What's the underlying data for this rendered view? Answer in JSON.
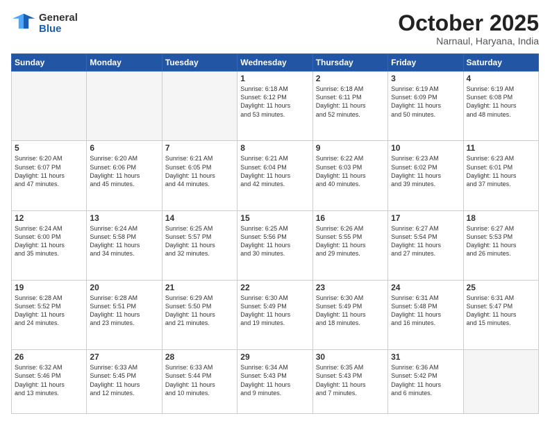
{
  "header": {
    "logo_general": "General",
    "logo_blue": "Blue",
    "month_title": "October 2025",
    "location": "Narnaul, Haryana, India"
  },
  "days_of_week": [
    "Sunday",
    "Monday",
    "Tuesday",
    "Wednesday",
    "Thursday",
    "Friday",
    "Saturday"
  ],
  "weeks": [
    [
      {
        "day": "",
        "info": ""
      },
      {
        "day": "",
        "info": ""
      },
      {
        "day": "",
        "info": ""
      },
      {
        "day": "1",
        "info": "Sunrise: 6:18 AM\nSunset: 6:12 PM\nDaylight: 11 hours\nand 53 minutes."
      },
      {
        "day": "2",
        "info": "Sunrise: 6:18 AM\nSunset: 6:11 PM\nDaylight: 11 hours\nand 52 minutes."
      },
      {
        "day": "3",
        "info": "Sunrise: 6:19 AM\nSunset: 6:09 PM\nDaylight: 11 hours\nand 50 minutes."
      },
      {
        "day": "4",
        "info": "Sunrise: 6:19 AM\nSunset: 6:08 PM\nDaylight: 11 hours\nand 48 minutes."
      }
    ],
    [
      {
        "day": "5",
        "info": "Sunrise: 6:20 AM\nSunset: 6:07 PM\nDaylight: 11 hours\nand 47 minutes."
      },
      {
        "day": "6",
        "info": "Sunrise: 6:20 AM\nSunset: 6:06 PM\nDaylight: 11 hours\nand 45 minutes."
      },
      {
        "day": "7",
        "info": "Sunrise: 6:21 AM\nSunset: 6:05 PM\nDaylight: 11 hours\nand 44 minutes."
      },
      {
        "day": "8",
        "info": "Sunrise: 6:21 AM\nSunset: 6:04 PM\nDaylight: 11 hours\nand 42 minutes."
      },
      {
        "day": "9",
        "info": "Sunrise: 6:22 AM\nSunset: 6:03 PM\nDaylight: 11 hours\nand 40 minutes."
      },
      {
        "day": "10",
        "info": "Sunrise: 6:23 AM\nSunset: 6:02 PM\nDaylight: 11 hours\nand 39 minutes."
      },
      {
        "day": "11",
        "info": "Sunrise: 6:23 AM\nSunset: 6:01 PM\nDaylight: 11 hours\nand 37 minutes."
      }
    ],
    [
      {
        "day": "12",
        "info": "Sunrise: 6:24 AM\nSunset: 6:00 PM\nDaylight: 11 hours\nand 35 minutes."
      },
      {
        "day": "13",
        "info": "Sunrise: 6:24 AM\nSunset: 5:58 PM\nDaylight: 11 hours\nand 34 minutes."
      },
      {
        "day": "14",
        "info": "Sunrise: 6:25 AM\nSunset: 5:57 PM\nDaylight: 11 hours\nand 32 minutes."
      },
      {
        "day": "15",
        "info": "Sunrise: 6:25 AM\nSunset: 5:56 PM\nDaylight: 11 hours\nand 30 minutes."
      },
      {
        "day": "16",
        "info": "Sunrise: 6:26 AM\nSunset: 5:55 PM\nDaylight: 11 hours\nand 29 minutes."
      },
      {
        "day": "17",
        "info": "Sunrise: 6:27 AM\nSunset: 5:54 PM\nDaylight: 11 hours\nand 27 minutes."
      },
      {
        "day": "18",
        "info": "Sunrise: 6:27 AM\nSunset: 5:53 PM\nDaylight: 11 hours\nand 26 minutes."
      }
    ],
    [
      {
        "day": "19",
        "info": "Sunrise: 6:28 AM\nSunset: 5:52 PM\nDaylight: 11 hours\nand 24 minutes."
      },
      {
        "day": "20",
        "info": "Sunrise: 6:28 AM\nSunset: 5:51 PM\nDaylight: 11 hours\nand 23 minutes."
      },
      {
        "day": "21",
        "info": "Sunrise: 6:29 AM\nSunset: 5:50 PM\nDaylight: 11 hours\nand 21 minutes."
      },
      {
        "day": "22",
        "info": "Sunrise: 6:30 AM\nSunset: 5:49 PM\nDaylight: 11 hours\nand 19 minutes."
      },
      {
        "day": "23",
        "info": "Sunrise: 6:30 AM\nSunset: 5:49 PM\nDaylight: 11 hours\nand 18 minutes."
      },
      {
        "day": "24",
        "info": "Sunrise: 6:31 AM\nSunset: 5:48 PM\nDaylight: 11 hours\nand 16 minutes."
      },
      {
        "day": "25",
        "info": "Sunrise: 6:31 AM\nSunset: 5:47 PM\nDaylight: 11 hours\nand 15 minutes."
      }
    ],
    [
      {
        "day": "26",
        "info": "Sunrise: 6:32 AM\nSunset: 5:46 PM\nDaylight: 11 hours\nand 13 minutes."
      },
      {
        "day": "27",
        "info": "Sunrise: 6:33 AM\nSunset: 5:45 PM\nDaylight: 11 hours\nand 12 minutes."
      },
      {
        "day": "28",
        "info": "Sunrise: 6:33 AM\nSunset: 5:44 PM\nDaylight: 11 hours\nand 10 minutes."
      },
      {
        "day": "29",
        "info": "Sunrise: 6:34 AM\nSunset: 5:43 PM\nDaylight: 11 hours\nand 9 minutes."
      },
      {
        "day": "30",
        "info": "Sunrise: 6:35 AM\nSunset: 5:43 PM\nDaylight: 11 hours\nand 7 minutes."
      },
      {
        "day": "31",
        "info": "Sunrise: 6:36 AM\nSunset: 5:42 PM\nDaylight: 11 hours\nand 6 minutes."
      },
      {
        "day": "",
        "info": ""
      }
    ]
  ]
}
